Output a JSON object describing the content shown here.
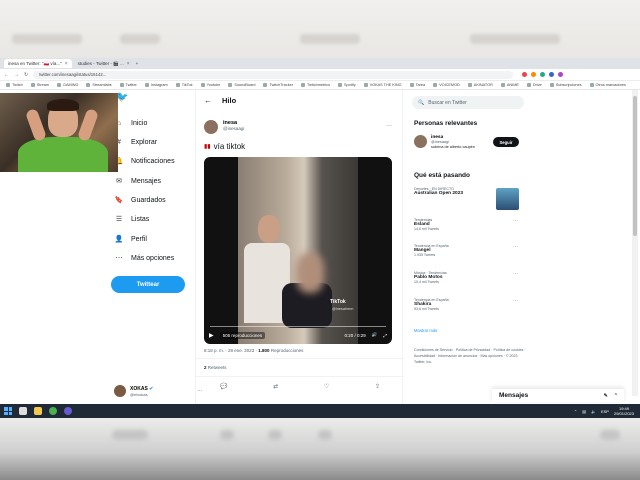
{
  "browser": {
    "tabs": [
      {
        "label": "inesa en Twitter: \"🇵🇱 vía...\""
      },
      {
        "label": "studies - Twitter - 🎬 ..."
      }
    ],
    "url": "twitter.com/inesaagi/status/16142...",
    "bookmarks": [
      "Twitch",
      "Stream",
      "GAMING",
      "Streamlabs",
      "Twitter",
      "Instagram",
      "TikTok",
      "Youtube",
      "SoundBoard",
      "TwitchTracker",
      "Twitchmetrics",
      "Spotify",
      "VOKAS THE KING",
      "Tarea",
      "VOICEMOD",
      "AKINATOR",
      "ANIME",
      "Drive",
      "Subscripciones",
      "Otros marcadores"
    ]
  },
  "nav": {
    "items": [
      {
        "label": "Inicio",
        "icon": "home-icon",
        "glyph": "⌂"
      },
      {
        "label": "Explorar",
        "icon": "hashtag-icon",
        "glyph": "#"
      },
      {
        "label": "Notificaciones",
        "icon": "bell-icon",
        "glyph": "🔔"
      },
      {
        "label": "Mensajes",
        "icon": "envelope-icon",
        "glyph": "✉"
      },
      {
        "label": "Guardados",
        "icon": "bookmark-icon",
        "glyph": "🔖"
      },
      {
        "label": "Listas",
        "icon": "list-icon",
        "glyph": "☰"
      },
      {
        "label": "Perfil",
        "icon": "person-icon",
        "glyph": "👤"
      },
      {
        "label": "Más opciones",
        "icon": "more-circle-icon",
        "glyph": "⋯"
      }
    ],
    "tweet_button": "Twittear",
    "account_name": "XOKAS",
    "account_handle": "@elxokas"
  },
  "thread": {
    "title": "Hilo",
    "author_name": "inesa",
    "author_handle": "@inesaagi",
    "text": "vía tiktok",
    "video": {
      "views": "505 reproducciones",
      "time": "0:20 / 0:29",
      "tiktok_label": "TikTok",
      "tiktok_handle": "@inesahmm"
    },
    "meta_date": "8:18 p. m. · 29 ene. 2023 · ",
    "meta_views": "1.800",
    "meta_views_label": " Reproducciones",
    "retweets_count": "2",
    "retweets_label": " Retweets"
  },
  "sidebar": {
    "search_placeholder": "Buscar en Twitter",
    "relevant_title": "Personas relevantes",
    "relevant_name": "inesa",
    "relevant_handle": "@inesaagi",
    "relevant_bio": "sobrina de alberto caupén",
    "follow_label": "Seguir",
    "trends_title": "Qué está pasando",
    "trends": [
      {
        "cat": "Deportes · EN DIRECTO",
        "name": "Australian Open 2023",
        "count": ""
      },
      {
        "cat": "Tendencias",
        "name": "Esland",
        "count": "14,6 mil Tweets"
      },
      {
        "cat": "Tendencia en España",
        "name": "Mangel",
        "count": "1.935 Tweets"
      },
      {
        "cat": "Música · Tendencias",
        "name": "Pablo Motos",
        "count": "10,4 mil Tweets"
      },
      {
        "cat": "Tendencia en España",
        "name": "Shakira",
        "count": "93,6 mil Tweets"
      }
    ],
    "show_more": "Mostrar más",
    "footer": "Condiciones de Servicio · Política de Privacidad · Política de cookies · Accesibilidad · Información de anuncios · Más opciones · © 2023 Twitter, Inc."
  },
  "messages_label": "Mensajes",
  "taskbar": {
    "time": "19:49",
    "date": "29/01/2023",
    "lang": "ESP"
  }
}
